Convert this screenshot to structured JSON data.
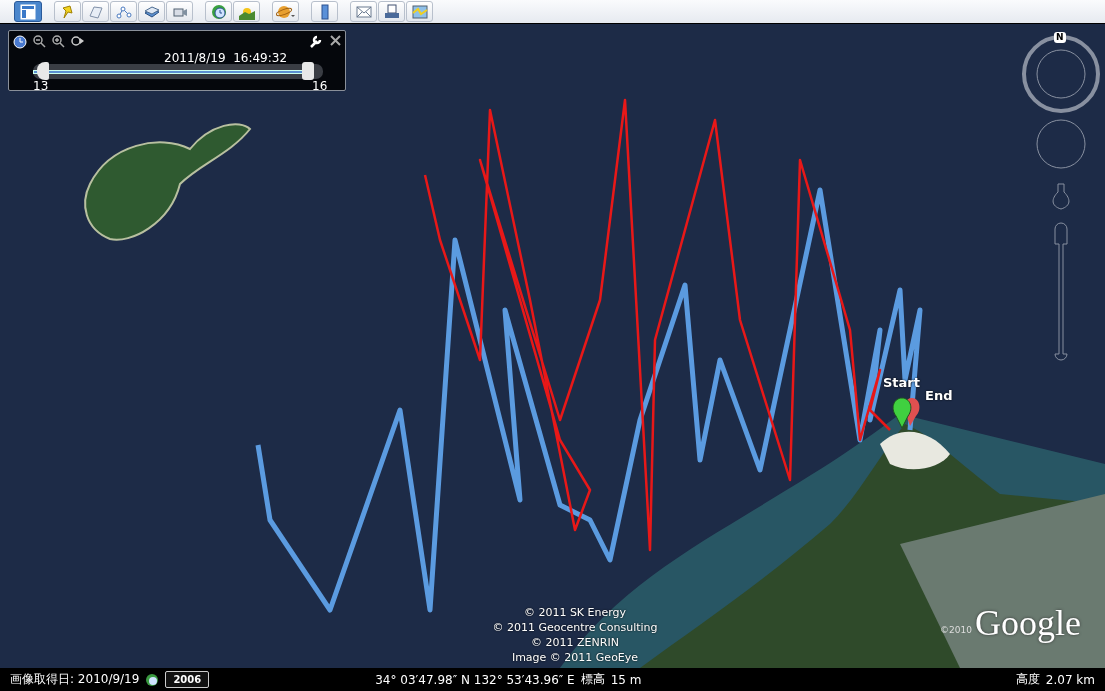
{
  "time_slider": {
    "datetime": "2011/8/19  16:49:32",
    "range_start": "13",
    "range_end": "16",
    "level": 0.97
  },
  "compass": {
    "north": "N"
  },
  "track_labels": [
    {
      "text": "Start",
      "kind": "start"
    },
    {
      "text": "End",
      "kind": "end"
    }
  ],
  "attribution": [
    "© 2011 SK Energy",
    "© 2011 Geocentre Consulting",
    "© 2011 ZENRIN",
    "Image © 2011 GeoEye"
  ],
  "logo": {
    "text": "Google",
    "year": "©2010"
  },
  "status_bar": {
    "imagery_date": "画像取得日: 2010/9/19",
    "historical_year": "2006",
    "coordinates": "34° 03′47.98″ N 132° 53′43.96″ E",
    "elevation_label": "標高",
    "elevation": "15 m",
    "altitude_label": "高度",
    "altitude": "2.07 km"
  }
}
